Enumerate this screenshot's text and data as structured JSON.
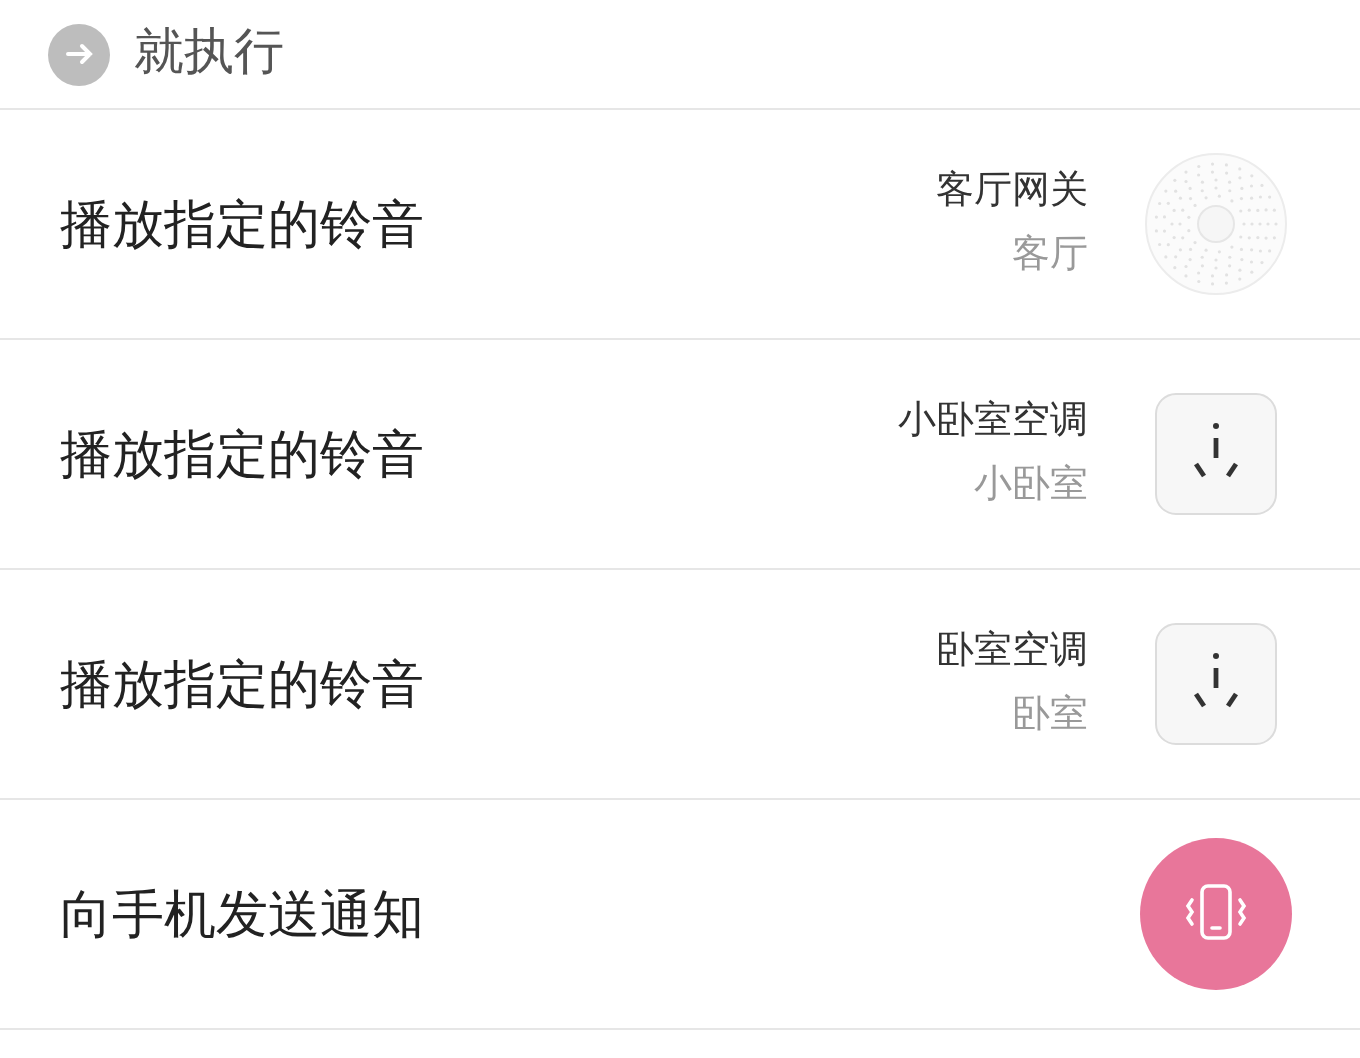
{
  "section": {
    "title": "就执行"
  },
  "actions": [
    {
      "label": "播放指定的铃音",
      "device": "客厅网关",
      "room": "客厅",
      "kind": "gateway"
    },
    {
      "label": "播放指定的铃音",
      "device": "小卧室空调",
      "room": "小卧室",
      "kind": "plug"
    },
    {
      "label": "播放指定的铃音",
      "device": "卧室空调",
      "room": "卧室",
      "kind": "plug"
    },
    {
      "label": "向手机发送通知",
      "kind": "phone"
    }
  ]
}
